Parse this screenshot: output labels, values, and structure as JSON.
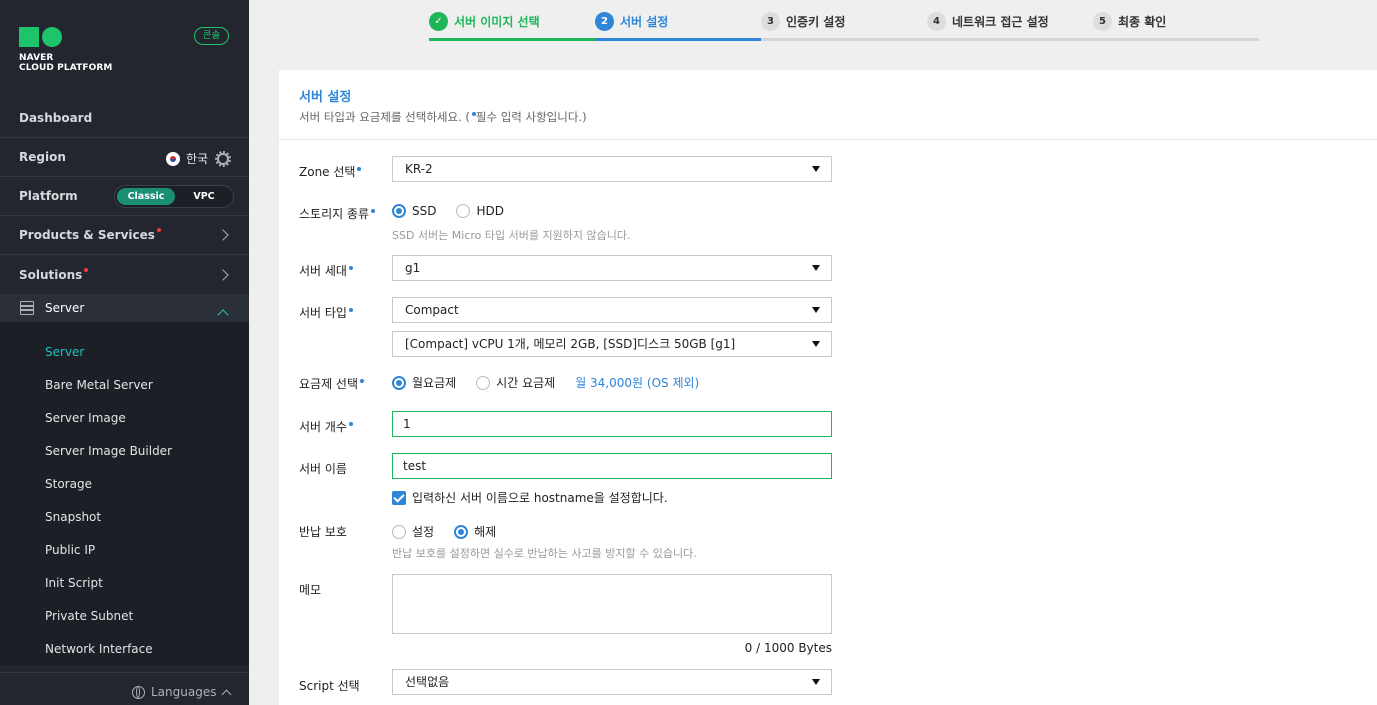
{
  "sidebar": {
    "logo_line1": "NAVER",
    "logo_line2": "CLOUD PLATFORM",
    "console_badge": "콘솔",
    "dashboard": "Dashboard",
    "region_label": "Region",
    "region_value": "한국",
    "platform_label": "Platform",
    "platform_on": "Classic",
    "platform_off": "VPC",
    "products": "Products & Services",
    "solutions": "Solutions",
    "server_header": "Server",
    "sub_items": [
      "Server",
      "Bare Metal Server",
      "Server Image",
      "Server Image Builder",
      "Storage",
      "Snapshot",
      "Public IP",
      "Init Script",
      "Private Subnet",
      "Network Interface"
    ],
    "languages": "Languages"
  },
  "stepper": {
    "steps": [
      {
        "num": "",
        "label": "서버 이미지 선택",
        "state": "done"
      },
      {
        "num": "2",
        "label": "서버 설정",
        "state": "current"
      },
      {
        "num": "3",
        "label": "인증키 설정",
        "state": "todo"
      },
      {
        "num": "4",
        "label": "네트워크 접근 설정",
        "state": "todo"
      },
      {
        "num": "5",
        "label": "최종 확인",
        "state": "todo"
      }
    ]
  },
  "form": {
    "title": "서버 설정",
    "desc_prefix": "서버 타입과 요금제를 선택하세요. (",
    "desc_suffix": "필수 입력 사항입니다.)",
    "zone_label": "Zone 선택",
    "zone_value": "KR-2",
    "storage_label": "스토리지 종류",
    "storage_opt1": "SSD",
    "storage_opt2": "HDD",
    "storage_hint": "SSD 서버는 Micro 타입 서버를 지원하지 않습니다.",
    "gen_label": "서버 세대",
    "gen_value": "g1",
    "type_label": "서버 타입",
    "type_value": "Compact",
    "spec_value": "[Compact] vCPU 1개, 메모리 2GB, [SSD]디스크 50GB [g1]",
    "plan_label": "요금제 선택",
    "plan_opt1": "월요금제",
    "plan_opt2": "시간 요금제",
    "plan_price": "월 34,000원 (OS 제외)",
    "count_label": "서버 개수",
    "count_value": "1",
    "name_label": "서버 이름",
    "name_value": "test",
    "hostname_check": "입력하신 서버 이름으로 hostname을 설정합니다.",
    "protect_label": "반납 보호",
    "protect_opt1": "설정",
    "protect_opt2": "해제",
    "protect_hint": "반납 보호를 설정하면 실수로 반납하는 사고를 방지할 수 있습니다.",
    "memo_label": "메모",
    "memo_counter": "0 / 1000 Bytes",
    "script_label": "Script 선택",
    "script_value": "선택없음"
  },
  "colors": {
    "brand_green": "#1ec46b",
    "accent_blue": "#2f86d7",
    "sidebar_bg": "#23262e",
    "active_teal": "#1ec4c4"
  }
}
